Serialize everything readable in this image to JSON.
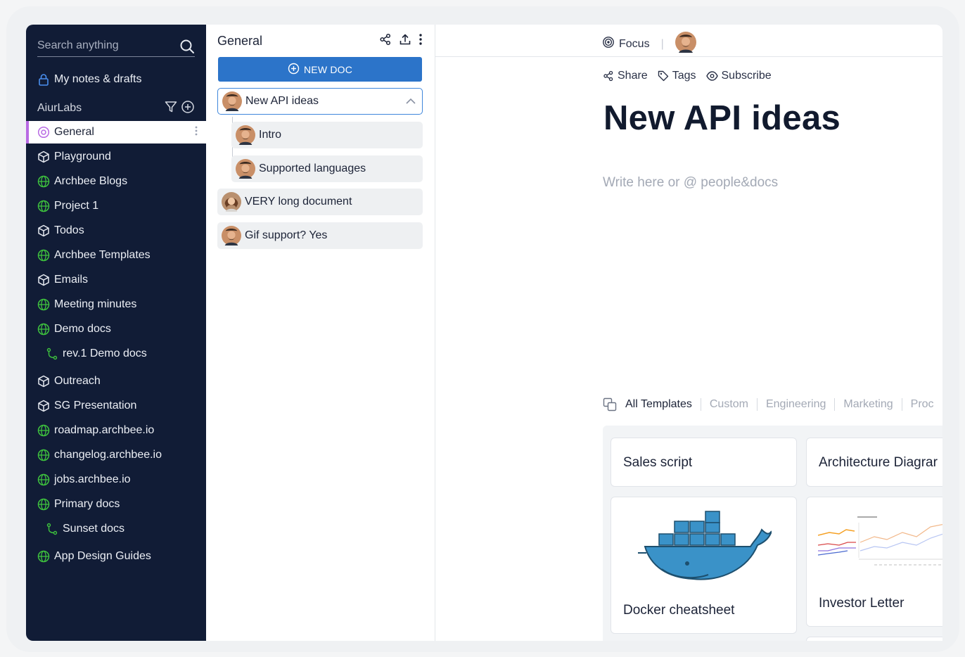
{
  "sidebar": {
    "search_placeholder": "Search anything",
    "my_notes_label": "My notes & drafts",
    "team_name": "AiurLabs",
    "items": [
      {
        "label": "General",
        "icon": "target-icon",
        "active": true
      },
      {
        "label": "Playground",
        "icon": "cube-icon"
      },
      {
        "label": "Archbee Blogs",
        "icon": "globe-icon"
      },
      {
        "label": "Project 1",
        "icon": "globe-icon"
      },
      {
        "label": "Todos",
        "icon": "cube-icon"
      },
      {
        "label": "Archbee Templates",
        "icon": "globe-icon"
      },
      {
        "label": "Emails",
        "icon": "cube-icon"
      },
      {
        "label": "Meeting minutes",
        "icon": "globe-icon"
      },
      {
        "label": "Demo docs",
        "icon": "globe-icon"
      },
      {
        "label": "rev.1 Demo docs",
        "icon": "branch-icon",
        "sub": true
      },
      {
        "label": "Outreach",
        "icon": "cube-icon"
      },
      {
        "label": "SG Presentation",
        "icon": "cube-icon"
      },
      {
        "label": "roadmap.archbee.io",
        "icon": "globe-icon"
      },
      {
        "label": "changelog.archbee.io",
        "icon": "globe-icon"
      },
      {
        "label": "jobs.archbee.io",
        "icon": "globe-icon"
      },
      {
        "label": "Primary docs",
        "icon": "globe-icon"
      },
      {
        "label": "Sunset docs",
        "icon": "branch-icon",
        "sub": true
      },
      {
        "label": "App Design Guides",
        "icon": "globe-icon"
      }
    ]
  },
  "middle": {
    "title": "General",
    "new_doc_label": "NEW DOC",
    "docs": [
      {
        "label": "New API ideas",
        "selected": true
      },
      {
        "label": "Intro",
        "child": true
      },
      {
        "label": "Supported languages",
        "child": true
      },
      {
        "label": "VERY long document"
      },
      {
        "label": "Gif support? Yes"
      }
    ]
  },
  "main": {
    "focus_label": "Focus",
    "share_label": "Share",
    "tags_label": "Tags",
    "subscribe_label": "Subscribe",
    "doc_title": "New API ideas",
    "placeholder": "Write here or @ people&docs",
    "template_tabs": [
      "All Templates",
      "Custom",
      "Engineering",
      "Marketing",
      "Proc"
    ],
    "templates": [
      "Sales script",
      "Architecture Diagrar",
      "Docker cheatsheet",
      "Investor Letter"
    ]
  },
  "colors": {
    "sidebar_bg": "#111c36",
    "accent_blue": "#2c74c9",
    "active_marker": "#b86ae3",
    "globe_green": "#3ec23e"
  }
}
